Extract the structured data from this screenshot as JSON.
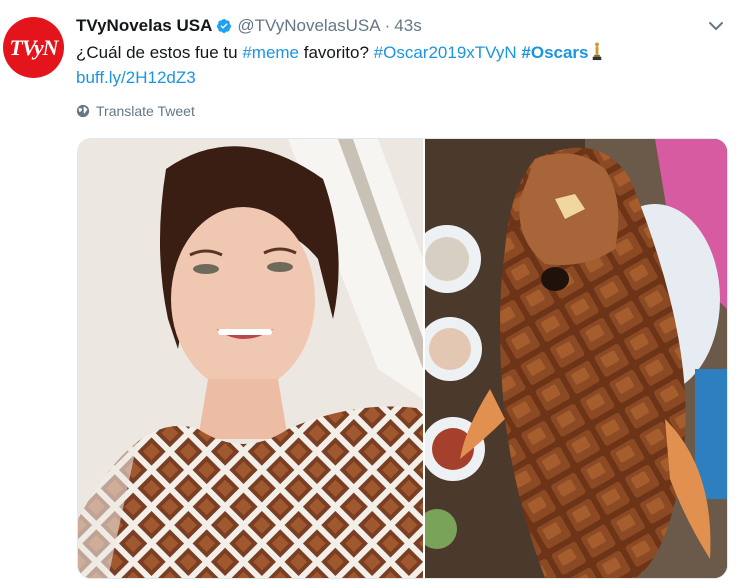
{
  "tweet": {
    "avatar_text": "TVyN",
    "display_name": "TVyNovelas USA",
    "handle": "@TVyNovelasUSA",
    "separator": "·",
    "timestamp": "43s",
    "text_part1": "¿Cuál de estos fue tu ",
    "hashtag_meme": "#meme",
    "text_part2": " favorito? ",
    "hashtag_oscar2019": "#Oscar2019xTVyN",
    "hashtag_oscars": "#Oscars",
    "link": "buff.ly/2H12dZ3",
    "translate_label": "Translate Tweet"
  },
  "colors": {
    "link": "#1b95e0",
    "avatar_bg": "#e3141b",
    "secondary_text": "#657786"
  },
  "icons": [
    "verified-badge-icon",
    "chevron-down-icon",
    "oscar-statuette-icon",
    "globe-icon"
  ]
}
